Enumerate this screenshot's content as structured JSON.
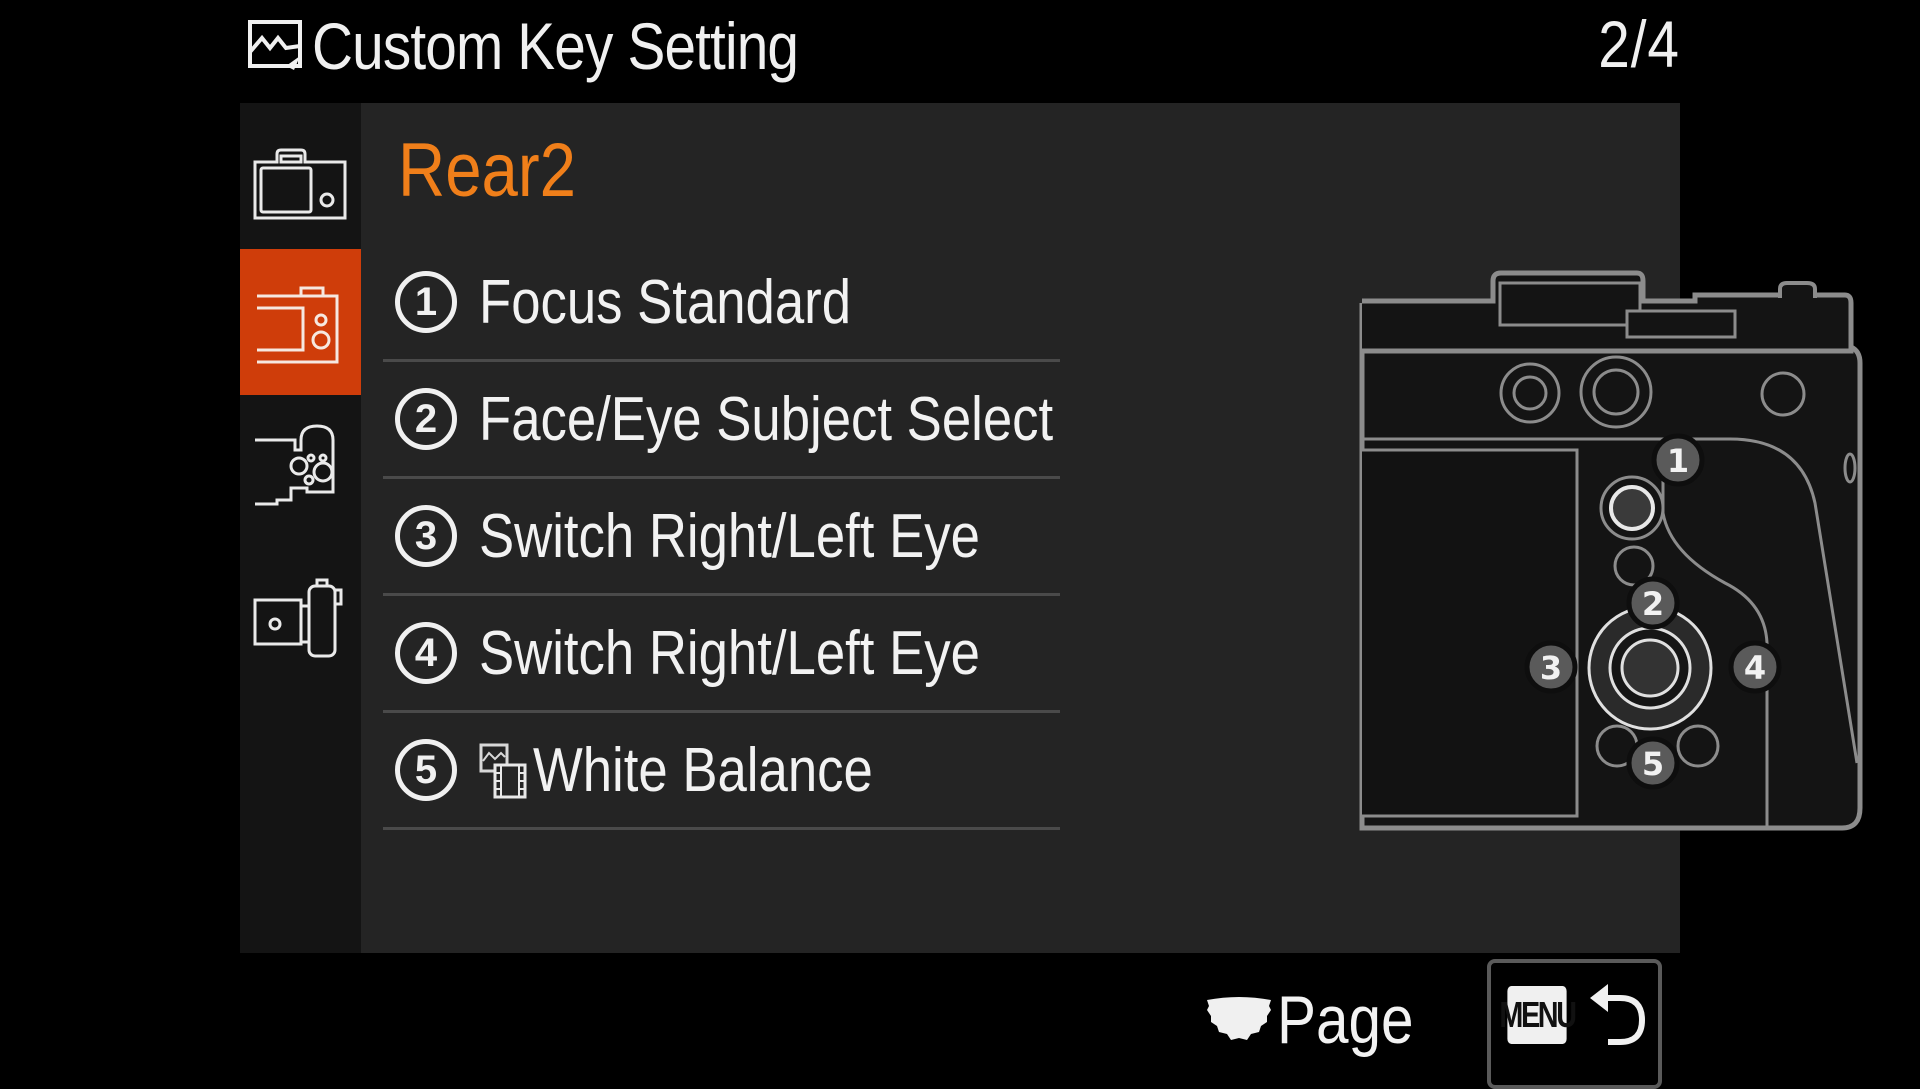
{
  "header": {
    "title": "Custom Key Setting",
    "title_icon": "still-image-icon",
    "page_indicator": "2/4"
  },
  "sidebar": {
    "items": [
      {
        "name": "camera-body-icon",
        "active": false
      },
      {
        "name": "rear-camera-icon",
        "active": true
      },
      {
        "name": "top-dial-camera-icon",
        "active": false
      },
      {
        "name": "lens-camera-icon",
        "active": false
      }
    ]
  },
  "section": {
    "title": "Rear2"
  },
  "list": {
    "items": [
      {
        "number": "1",
        "label": "Focus Standard",
        "icon": null
      },
      {
        "number": "2",
        "label": "Face/Eye Subject Select",
        "icon": null
      },
      {
        "number": "3",
        "label": "Switch Right/Left Eye",
        "icon": null
      },
      {
        "number": "4",
        "label": "Switch Right/Left Eye",
        "icon": null
      },
      {
        "number": "5",
        "label": "White Balance",
        "icon": "still-movie-icon"
      }
    ]
  },
  "diagram": {
    "callouts": [
      "1",
      "2",
      "3",
      "4",
      "5"
    ]
  },
  "footer": {
    "page_label": "Page",
    "page_icon": "control-wheel-icon",
    "menu_key": "MENU",
    "back_icon": "return-icon"
  },
  "colors": {
    "accent_orange": "#f07f1a",
    "active_tab": "#cf3d0a",
    "panel_bg": "#242424",
    "sidebar_bg": "#141414"
  }
}
